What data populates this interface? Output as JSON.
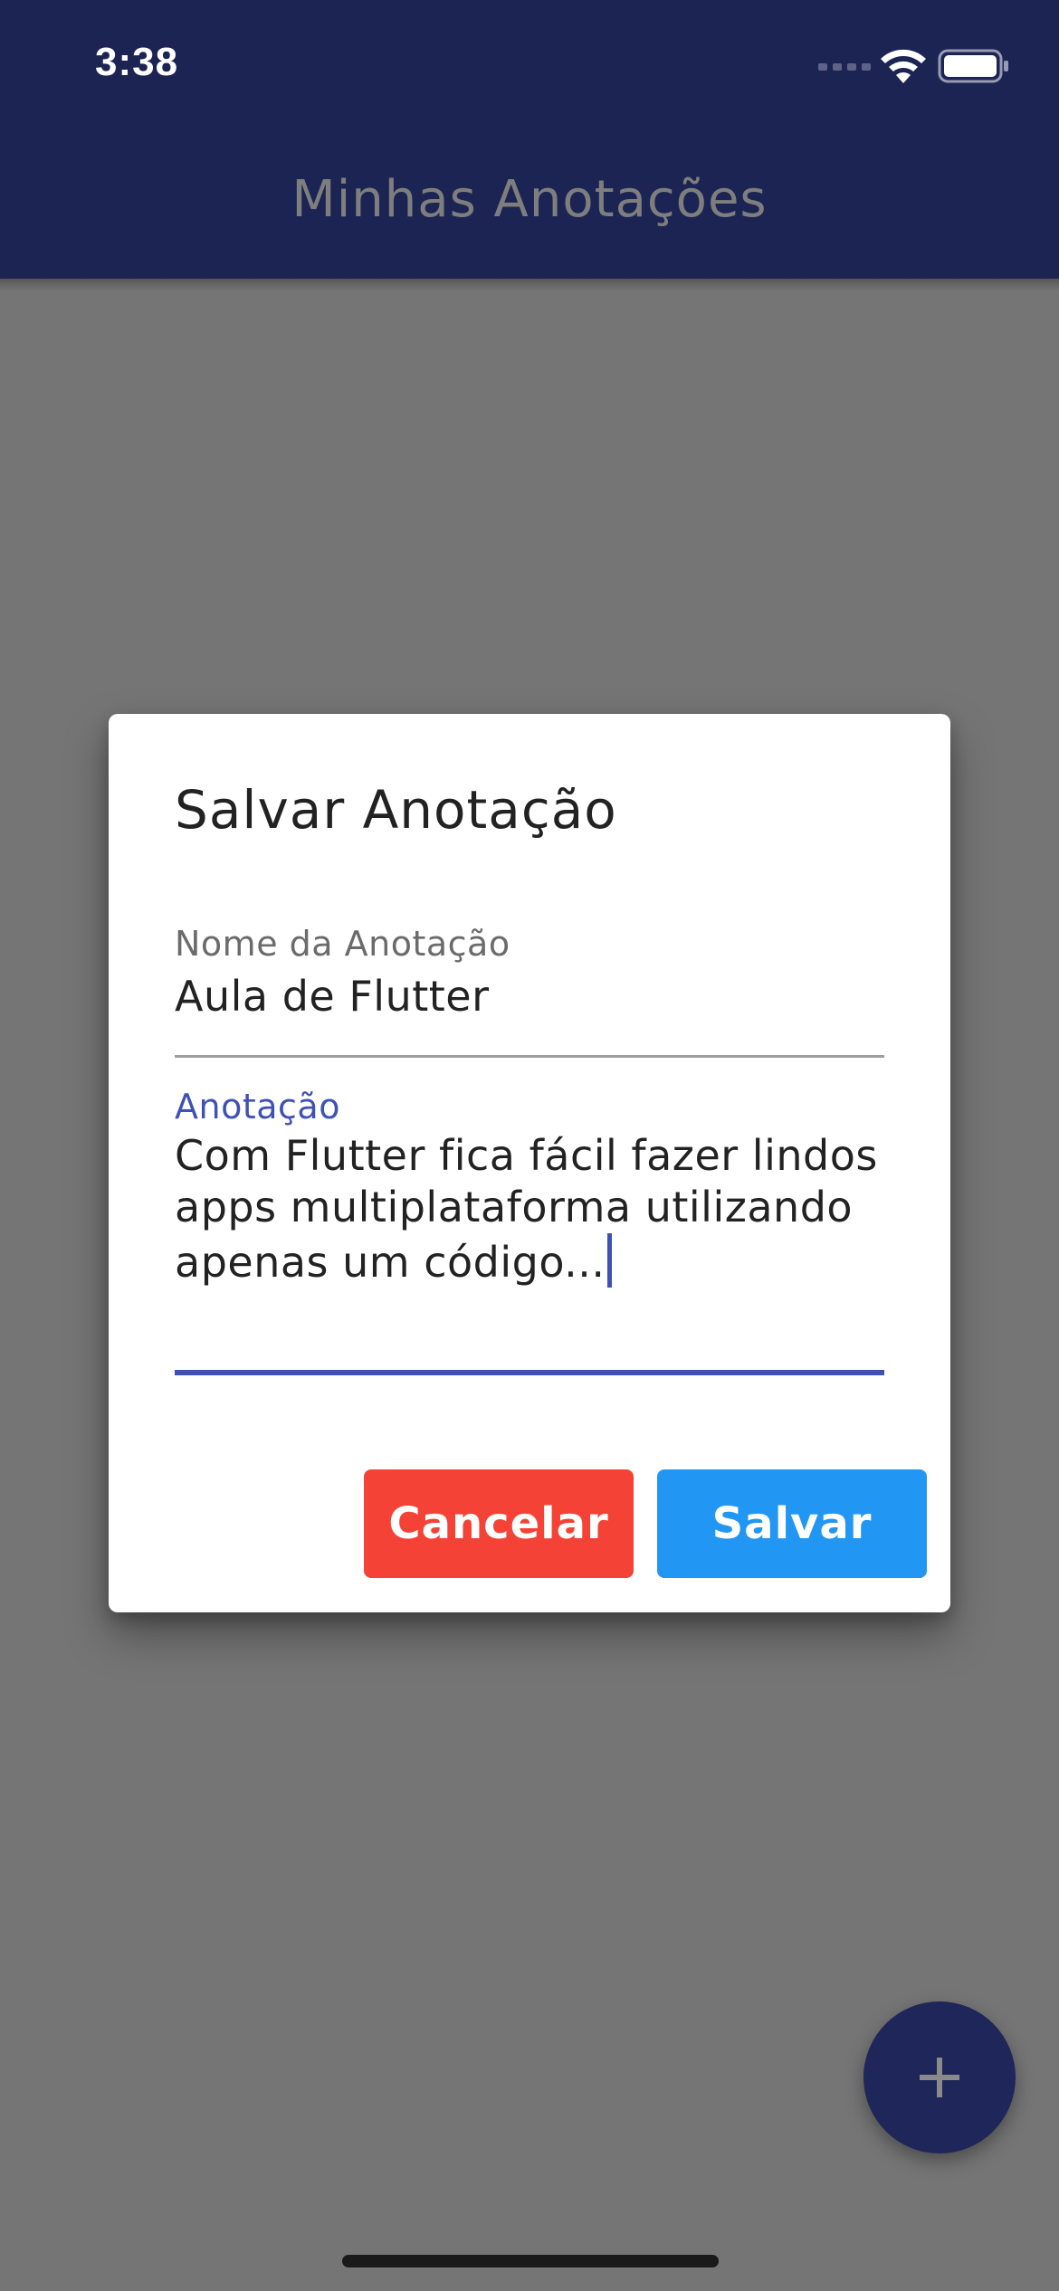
{
  "status_bar": {
    "time": "3:38",
    "icons": [
      "cellular-signal-icon",
      "wifi-icon",
      "battery-icon"
    ]
  },
  "app_bar": {
    "title": "Minhas Anotações"
  },
  "dialog": {
    "title": "Salvar Anotação",
    "name_field": {
      "label": "Nome da Anotação",
      "value": "Aula de Flutter"
    },
    "note_field": {
      "label": "Anotação",
      "value": "Com Flutter fica fácil fazer lindos apps multiplataforma utilizando apenas um código..."
    },
    "cancel_label": "Cancelar",
    "save_label": "Salvar"
  },
  "fab": {
    "icon": "plus-icon"
  },
  "colors": {
    "app_bar": "#1c2454",
    "fab": "#1f2659",
    "accent": "#3f51b5",
    "cancel_button": "#f44336",
    "save_button": "#2196f3"
  }
}
